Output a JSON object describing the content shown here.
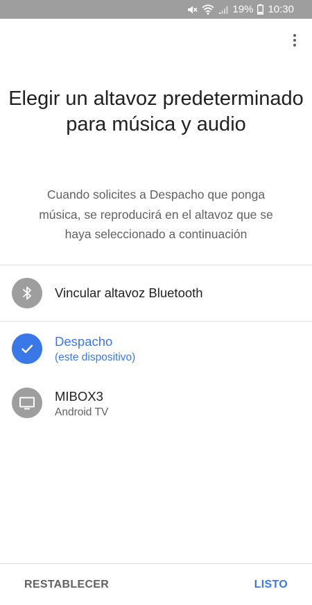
{
  "status_bar": {
    "battery_percent": "19%",
    "time": "10:30",
    "icons": [
      "mute-icon",
      "wifi-icon",
      "signal-icon",
      "battery-icon"
    ]
  },
  "header": {
    "menu_icon": "more-vert-icon"
  },
  "main": {
    "title": "Elegir un altavoz predeterminado para música y audio",
    "description": "Cuando solicites a Despacho que ponga música, se reproducirá en el altavoz que se haya seleccionado a continuación"
  },
  "options": {
    "bluetooth": {
      "label": "Vincular altavoz Bluetooth",
      "icon": "bluetooth-icon"
    },
    "speakers": [
      {
        "name": "Despacho",
        "subtitle": "(este dispositivo)",
        "selected": true,
        "icon": "check-icon"
      },
      {
        "name": "MIBOX3",
        "subtitle": "Android TV",
        "selected": false,
        "icon": "tv-icon"
      }
    ]
  },
  "footer": {
    "reset_label": "RESTABLECER",
    "done_label": "LISTO"
  },
  "colors": {
    "accent": "#3b78e7",
    "status_bar": "#9e9e9e",
    "icon_circle": "#9e9e9e"
  }
}
